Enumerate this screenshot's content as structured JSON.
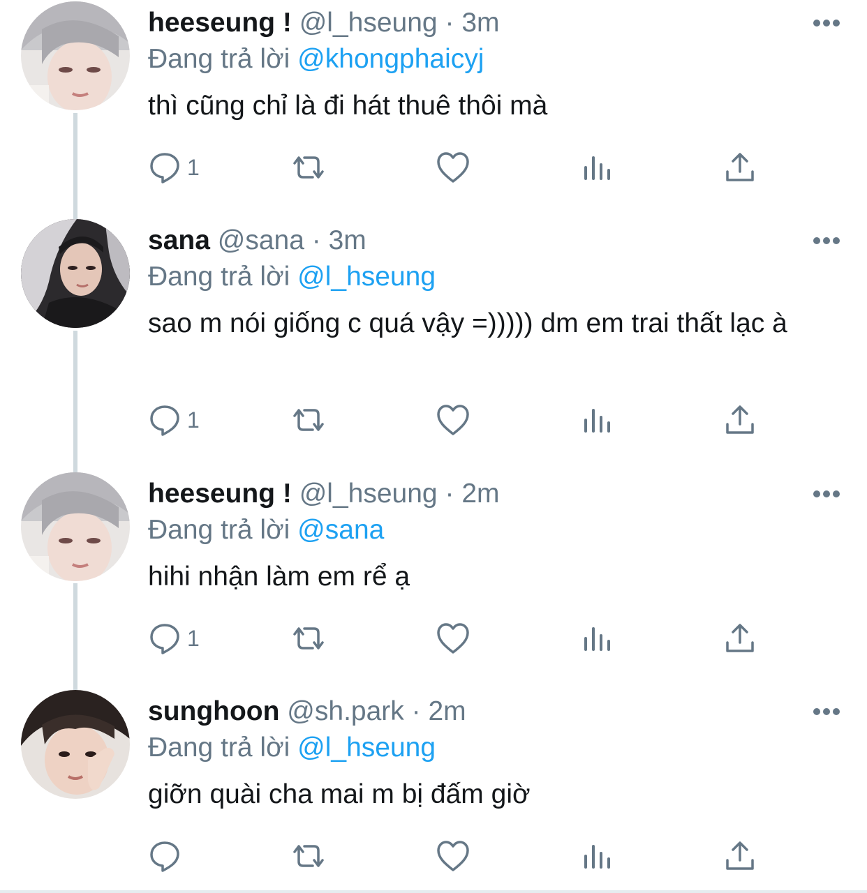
{
  "tweets": [
    {
      "name": "heeseung !",
      "handle": "@l_hseung",
      "separator": "·",
      "time": "3m",
      "reply_prefix": "Đang trả lời",
      "reply_to": "@khongphaicyj",
      "text": "thì cũng chỉ là đi hát thuê thôi mà",
      "reply_count": "1",
      "avatar_icon": "user-avatar-silver-hair"
    },
    {
      "name": "sana",
      "handle": "@sana",
      "separator": "·",
      "time": "3m",
      "reply_prefix": "Đang trả lời",
      "reply_to": "@l_hseung",
      "text": "sao m nói giống c quá vậy =))))) dm em trai thất lạc à",
      "reply_count": "1",
      "avatar_icon": "user-avatar-dark-hair"
    },
    {
      "name": "heeseung !",
      "handle": "@l_hseung",
      "separator": "·",
      "time": "2m",
      "reply_prefix": "Đang trả lời",
      "reply_to": "@sana",
      "text": "hihi nhận làm em rể ạ",
      "reply_count": "1",
      "avatar_icon": "user-avatar-silver-hair"
    },
    {
      "name": "sunghoon",
      "handle": "@sh.park",
      "separator": "·",
      "time": "2m",
      "reply_prefix": "Đang trả lời",
      "reply_to": "@l_hseung",
      "text": "giỡn quài cha mai m bị đấm giờ",
      "reply_count": "",
      "avatar_icon": "user-avatar-brown-hair"
    }
  ],
  "colors": {
    "text": "#14171a",
    "secondary": "#657786",
    "accent": "#1da1f2",
    "icon": "#657786",
    "thread_line": "#cfd9de"
  },
  "icons": [
    "more-icon",
    "reply-icon",
    "retweet-icon",
    "like-icon",
    "analytics-icon",
    "share-icon"
  ]
}
